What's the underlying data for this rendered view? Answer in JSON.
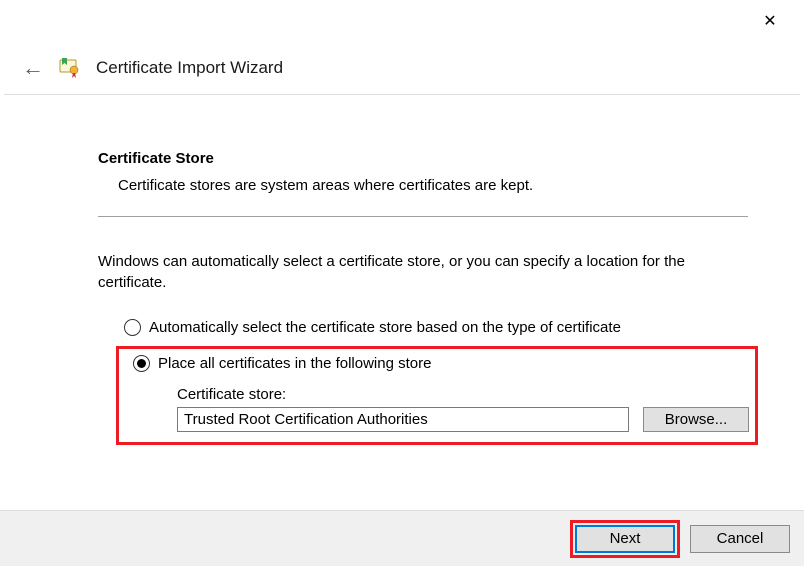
{
  "window": {
    "close_glyph": "✕"
  },
  "header": {
    "back_glyph": "←",
    "title": "Certificate Import Wizard"
  },
  "section": {
    "title": "Certificate Store",
    "desc": "Certificate stores are system areas where certificates are kept."
  },
  "body": {
    "intro": "Windows can automatically select a certificate store, or you can specify a location for the certificate.",
    "radio_auto": "Automatically select the certificate store based on the type of certificate",
    "radio_manual": "Place all certificates in the following store",
    "store_label": "Certificate store:",
    "store_value": "Trusted Root Certification Authorities",
    "browse_label": "Browse...",
    "selected": "manual"
  },
  "footer": {
    "next_label": "Next",
    "cancel_label": "Cancel"
  }
}
